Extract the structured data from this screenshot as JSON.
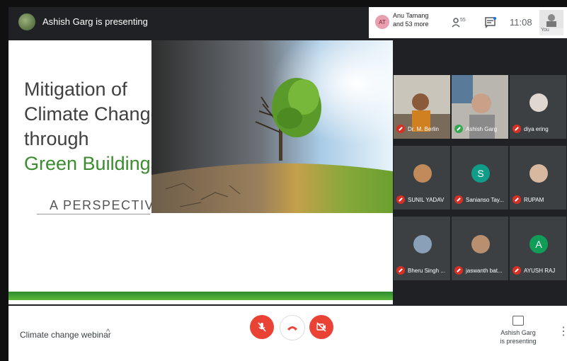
{
  "topbar": {
    "presenter_status": "Ashish Garg is presenting",
    "participants_line1": "Anu Tamang",
    "participants_line2": "and 53 more",
    "participant_count": "55",
    "time": "11:08",
    "self_label": "You"
  },
  "slide": {
    "title_lines": [
      "Mitigation of",
      "Climate Change",
      "through"
    ],
    "title_green": "Green Buildings",
    "subtitle": "A PERSPECTIVE",
    "title_color": "#404040",
    "green_color": "#3a8c2e"
  },
  "participants": [
    {
      "name": "Dr. M. Berlin",
      "type": "video"
    },
    {
      "name": "Ashish Garg",
      "type": "video"
    },
    {
      "name": "diya ering",
      "type": "photo"
    },
    {
      "name": "SUNIL YADAV",
      "type": "photo"
    },
    {
      "name": "Sanianso Tay...",
      "type": "letter",
      "letter": "S",
      "color": "#0f9d8a"
    },
    {
      "name": "RUPAM",
      "type": "photo"
    },
    {
      "name": "Bheru Singh ...",
      "type": "photo"
    },
    {
      "name": "jaswanth bat...",
      "type": "photo"
    },
    {
      "name": "AYUSH RAJ",
      "type": "letter",
      "letter": "A",
      "color": "#0f9d58"
    }
  ],
  "bottombar": {
    "meeting_name": "Climate change webinar",
    "caret": "^",
    "present_line1": "Ashish Garg",
    "present_line2": "is presenting",
    "more": "⋮"
  },
  "colors": {
    "bar_dark": "#202124",
    "danger": "#ea4335",
    "muted": "#d93025"
  }
}
